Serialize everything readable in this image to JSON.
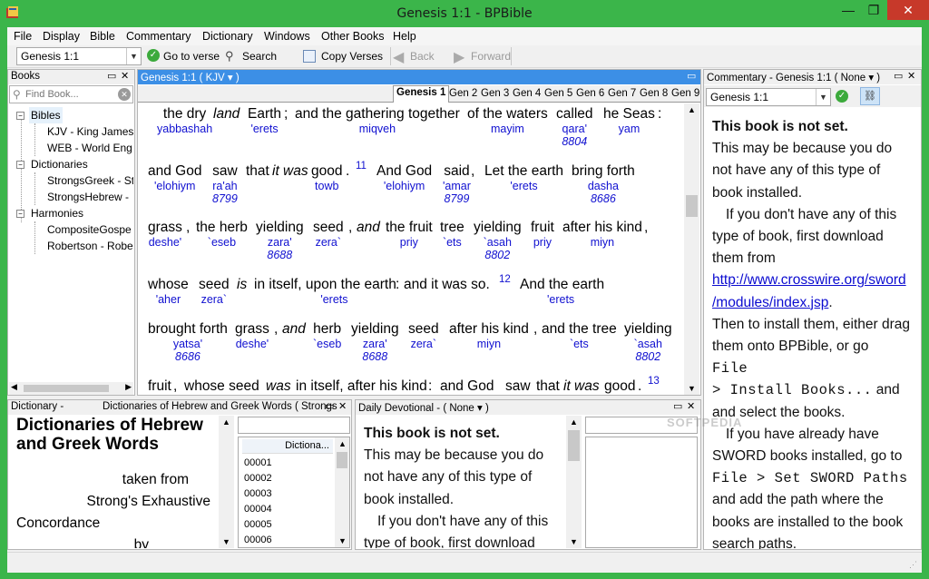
{
  "window": {
    "title": "Genesis 1:1 - BPBible"
  },
  "menu": [
    "File",
    "Display",
    "Bible",
    "Commentary",
    "Dictionary",
    "Windows",
    "Other Books",
    "Help"
  ],
  "toolbar": {
    "ref": "Genesis 1:1",
    "goto": "Go to verse",
    "search": "Search",
    "copy": "Copy Verses",
    "back": "Back",
    "forward": "Forward"
  },
  "books_pane": {
    "title": "Books",
    "placeholder": "Find Book...",
    "tree": {
      "bibles": "Bibles",
      "kjv": "KJV - King James",
      "web": "WEB - World Eng",
      "dictionaries": "Dictionaries",
      "greek": "StrongsGreek - St",
      "hebrew": "StrongsHebrew -",
      "harmonies": "Harmonies",
      "composite": "CompositeGospe",
      "robertson": "Robertson - Robe"
    }
  },
  "bible_pane": {
    "title": "Genesis 1:1 ( KJV ▾ )",
    "tabs": [
      "Genesis 1",
      "Gen 2",
      "Gen 3",
      "Gen 4",
      "Gen 5",
      "Gen 6",
      "Gen 7",
      "Gen 8",
      "Gen 9"
    ],
    "verse_numbers": [
      "11",
      "12",
      "13"
    ],
    "lines": {
      "l1": [
        "the dry",
        "land",
        "Earth",
        ";",
        "and the gathering together",
        "of the waters",
        "called",
        "he Seas",
        ":"
      ],
      "l1t": [
        "yabbashah",
        "'erets",
        "miqveh",
        "mayim",
        "qara'",
        "yam"
      ],
      "l1n": [
        "8804"
      ],
      "l2": [
        "and God",
        "saw",
        "that",
        "it was",
        "good",
        ".",
        "And God",
        "said",
        ",",
        "Let the earth",
        "bring forth"
      ],
      "l2t": [
        "'elohiym",
        "ra'ah",
        "towb",
        "'elohiym",
        "'amar",
        "'erets",
        "dasha"
      ],
      "l2n": [
        "8799",
        "8799",
        "8686"
      ],
      "l3": [
        "grass",
        ",",
        "the herb",
        "yielding",
        "seed",
        ",",
        "and",
        "the fruit",
        "tree",
        "yielding",
        "fruit",
        "after his kind",
        ","
      ],
      "l3t": [
        "deshe'",
        "`eseb",
        "zara'",
        "zera`",
        "priy",
        "`ets",
        "`asah",
        "priy",
        "miyn"
      ],
      "l3n": [
        "8688",
        "8802"
      ],
      "l4": [
        "whose",
        "seed",
        "is",
        "in itself, upon the earth",
        ":",
        "and it was so.",
        "And the earth"
      ],
      "l4t": [
        "'aher",
        "zera`",
        "'erets",
        "'erets"
      ],
      "l5": [
        "brought forth",
        "grass",
        ",",
        "and",
        "herb",
        "yielding",
        "seed",
        "after his kind",
        ",",
        "and the tree",
        "yielding"
      ],
      "l5t": [
        "yatsa'",
        "deshe'",
        "`eseb",
        "zara'",
        "zera`",
        "miyn",
        "`ets",
        "`asah"
      ],
      "l5n": [
        "8686",
        "8688",
        "8802"
      ],
      "l6": [
        "fruit",
        ",",
        "whose seed",
        "was",
        "in itself, after his kind",
        ":",
        "and God",
        "saw",
        "that",
        "it was",
        "good",
        "."
      ]
    }
  },
  "commentary_pane": {
    "title": "Commentary - Genesis 1:1 ( None ▾ )",
    "ref": "Genesis 1:1",
    "not_set": "This book is not set.",
    "p1": "This may be because you do not have any of this type of book installed.",
    "p2a": "If you don't have any of this type of book, first download them from",
    "url1": "http://www.crosswire.org/sword",
    "url2": "/modules/index.jsp",
    "p2c": "Then to install them, either drag them onto BPBible, or go",
    "cmd1a": "File",
    "cmd1b": "> Install Books...",
    "p2d": "and select the books.",
    "p3a": "If you have already have SWORD books installed, go to",
    "cmd2": "File > Set SWORD Paths",
    "p3b": "and add the path where the books are installed to the book search paths."
  },
  "dictionary_pane": {
    "title_left": "Dictionary -",
    "title_right": "Dictionaries of Hebrew and Greek Words ( Strongs",
    "heading": "Dictionaries of Hebrew and Greek Words",
    "line1": "taken from",
    "line2": "Strong's Exhaustive",
    "line3": "Concordance",
    "line4": "by",
    "list_header": "Dictiona...",
    "entries": [
      "00001",
      "00002",
      "00003",
      "00004",
      "00005",
      "00006"
    ]
  },
  "devotional_pane": {
    "title": "Daily Devotional - ( None ▾ )",
    "not_set": "This book is not set.",
    "p1": "This may be because you do not have any of this type of book installed.",
    "p2": "If you don't have any of this type of book, first download"
  },
  "watermark": "SOFTPEDIA",
  "colors": {
    "frame": "#3bb54a",
    "active_head": "#3c8fe6",
    "strongs": "#1010d0",
    "close": "#c7392a"
  }
}
